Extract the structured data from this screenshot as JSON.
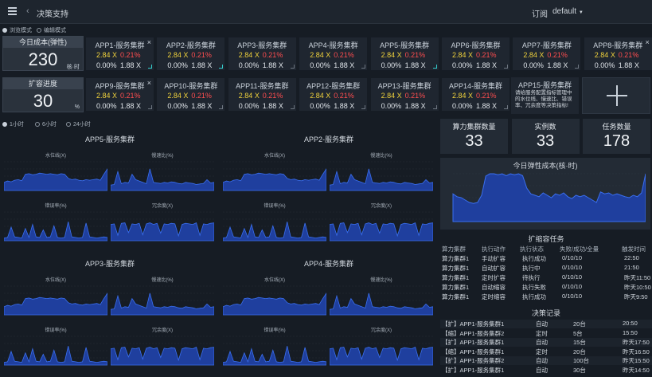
{
  "topbar": {
    "title": "决策支持",
    "subscribe": "订阅",
    "user": "default"
  },
  "modes": [
    "浏览模式",
    "编辑模式"
  ],
  "ranges": [
    "1小时",
    "6小时",
    "24小时"
  ],
  "cost_cards": [
    {
      "title": "今日成本(弹性)",
      "value": "230",
      "unit": "核·时"
    },
    {
      "title": "扩容进度",
      "value": "30",
      "unit": "%"
    }
  ],
  "apps_row1": [
    {
      "name": "APP1-服务集群",
      "a": "2.84 X",
      "b": "0.21%",
      "c": "0.00%",
      "d": "1.88 X",
      "close": true,
      "corner": "teal"
    },
    {
      "name": "APP2-服务集群",
      "a": "2.84 X",
      "b": "0.21%",
      "c": "0.00%",
      "d": "1.88 X",
      "close": false,
      "corner": "teal"
    },
    {
      "name": "APP3-服务集群",
      "a": "2.84 X",
      "b": "0.21%",
      "c": "0.00%",
      "d": "1.88 X",
      "close": false,
      "corner": "gray"
    },
    {
      "name": "APP4-服务集群",
      "a": "2.84 X",
      "b": "0.21%",
      "c": "0.00%",
      "d": "1.88 X",
      "close": false,
      "corner": "gray"
    },
    {
      "name": "APP5-服务集群",
      "a": "2.84 X",
      "b": "0.21%",
      "c": "0.00%",
      "d": "1.88 X",
      "close": false,
      "corner": "teal"
    },
    {
      "name": "APP6-服务集群",
      "a": "2.84 X",
      "b": "0.21%",
      "c": "0.00%",
      "d": "1.88 X",
      "close": false,
      "corner": "gray"
    },
    {
      "name": "APP7-服务集群",
      "a": "2.84 X",
      "b": "0.21%",
      "c": "0.00%",
      "d": "1.88 X",
      "close": false,
      "corner": "gray"
    },
    {
      "name": "APP8-服务集群",
      "a": "2.84 X",
      "b": "0.21%",
      "c": "0.00%",
      "d": "1.88 X",
      "close": true,
      "corner": "none"
    }
  ],
  "apps_row2": [
    {
      "name": "APP9-服务集群",
      "a": "2.84 X",
      "b": "0.21%",
      "c": "0.00%",
      "d": "1.88 X",
      "close": true,
      "corner": "gray"
    },
    {
      "name": "APP10-服务集群",
      "a": "2.84 X",
      "b": "0.21%",
      "c": "0.00%",
      "d": "1.88 X",
      "close": false,
      "corner": "gray"
    },
    {
      "name": "APP11-服务集群",
      "a": "2.84 X",
      "b": "0.21%",
      "c": "0.00%",
      "d": "1.88 X",
      "close": false,
      "corner": "gray"
    },
    {
      "name": "APP12-服务集群",
      "a": "2.84 X",
      "b": "0.21%",
      "c": "0.00%",
      "d": "1.88 X",
      "close": false,
      "corner": "gray"
    },
    {
      "name": "APP13-服务集群",
      "a": "2.84 X",
      "b": "0.21%",
      "c": "0.00%",
      "d": "1.88 X",
      "close": false,
      "corner": "gray"
    },
    {
      "name": "APP14-服务集群",
      "a": "2.84 X",
      "b": "0.21%",
      "c": "0.00%",
      "d": "1.88 X",
      "close": false,
      "corner": "gray"
    }
  ],
  "app15": {
    "name": "APP15-服务集群",
    "desc": "请给服务配置指标管理中的水位线、慢速比、错误率、冗余度等决策指标!"
  },
  "stats": [
    {
      "title": "算力集群数量",
      "value": "33"
    },
    {
      "title": "实例数",
      "value": "33"
    },
    {
      "title": "任务数量",
      "value": "178"
    }
  ],
  "groups": [
    {
      "title": "APP5-服务集群",
      "charts": [
        "水位线(X)",
        "慢速比(%)",
        "错误率(%)",
        "冗余度(X)"
      ]
    },
    {
      "title": "APP2-服务集群",
      "charts": [
        "水位线(X)",
        "慢速比(%)",
        "错误率(%)",
        "冗余度(X)"
      ]
    },
    {
      "title": "APP3-服务集群",
      "charts": [
        "水位线(X)",
        "慢速比(%)",
        "错误率(%)",
        "冗余度(X)"
      ]
    },
    {
      "title": "APP4-服务集群",
      "charts": [
        "水位线(X)",
        "慢速比(%)",
        "错误率(%)",
        "冗余度(X)"
      ]
    }
  ],
  "chart_data": {
    "type": "area",
    "title": "今日弹性成本(核·时)",
    "x": [
      0,
      1,
      2,
      3,
      4,
      5,
      6,
      7,
      8,
      9,
      10,
      11,
      12,
      13,
      14,
      15,
      16,
      17,
      18,
      19,
      20,
      21,
      22,
      23,
      24,
      25,
      26,
      27,
      28,
      29,
      30,
      31,
      32,
      33,
      34,
      35,
      36,
      37,
      38,
      39,
      40,
      41,
      42,
      43,
      44,
      45,
      46,
      47
    ],
    "values": [
      58,
      52,
      50,
      45,
      40,
      38,
      40,
      55,
      95,
      100,
      100,
      98,
      100,
      96,
      100,
      98,
      100,
      96,
      70,
      58,
      55,
      52,
      60,
      55,
      50,
      58,
      55,
      60,
      52,
      48,
      55,
      52,
      55,
      50,
      45,
      40,
      62,
      58,
      60,
      55,
      58,
      55,
      52,
      50,
      55,
      52,
      60,
      100
    ]
  },
  "tasks": {
    "title": "扩缩容任务",
    "headers": [
      "算力集群",
      "执行动作",
      "执行状态",
      "失败/成功/全量",
      "触发时间"
    ],
    "rows": [
      [
        "算力集群1",
        "手动扩容",
        "执行成功",
        "0/10/10",
        "22:50"
      ],
      [
        "算力集群1",
        "自动扩容",
        "执行中",
        "0/10/10",
        "21:50"
      ],
      [
        "算力集群1",
        "定时扩容",
        "待执行",
        "0/10/10",
        "昨天11:50"
      ],
      [
        "算力集群1",
        "自动缩容",
        "执行失败",
        "0/10/10",
        "昨天10:50"
      ],
      [
        "算力集群1",
        "定时缩容",
        "执行成功",
        "0/10/10",
        "昨天9:50"
      ]
    ]
  },
  "records": {
    "title": "决策记录",
    "rows": [
      [
        "【扩】APP1-服务集群1",
        "自动",
        "20台",
        "20:50"
      ],
      [
        "【缩】APP1-服务集群2",
        "定时",
        "5台",
        "15:50"
      ],
      [
        "【扩】APP1-服务集群1",
        "自动",
        "15台",
        "昨天17:50"
      ],
      [
        "【缩】APP1-服务集群1",
        "定时",
        "20台",
        "昨天16:50"
      ],
      [
        "【扩】APP1-服务集群2",
        "自动",
        "100台",
        "昨天15:50"
      ],
      [
        "【扩】APP1-服务集群1",
        "自动",
        "30台",
        "昨天14:50"
      ]
    ]
  },
  "colors": {
    "accent": "#2f5fd6",
    "fill": "#1f3f9e",
    "bg": "#161c24",
    "panel": "#232b35"
  }
}
